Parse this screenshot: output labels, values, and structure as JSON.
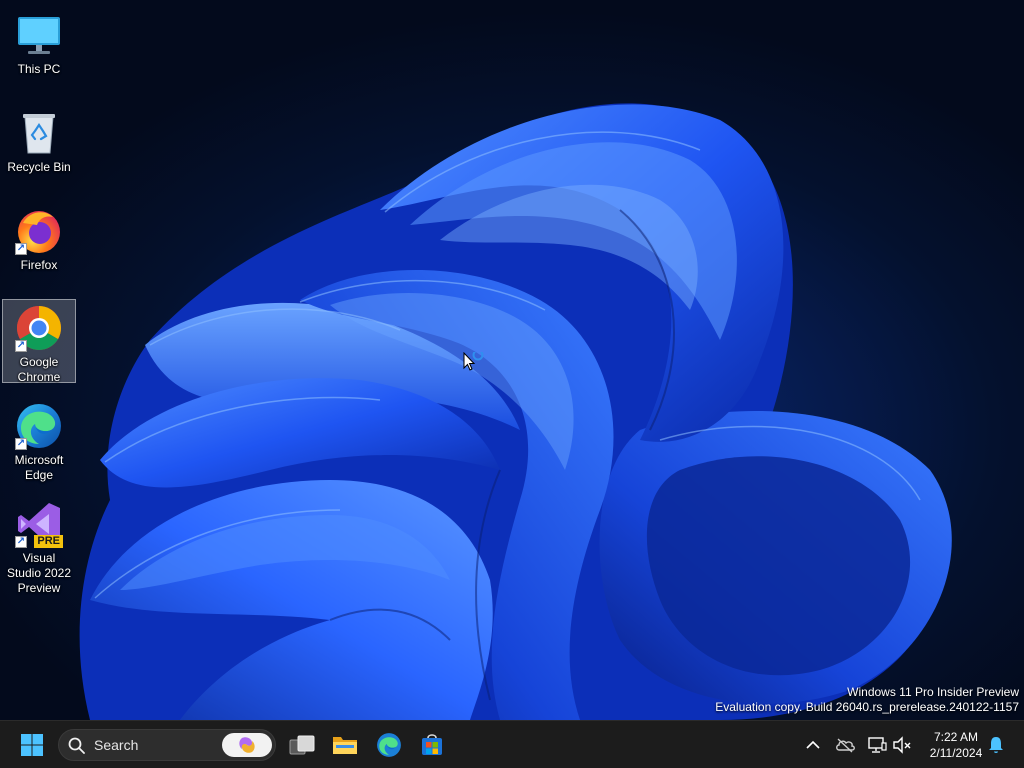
{
  "desktop": {
    "icons": [
      {
        "label": "This PC",
        "icon": "monitor-icon"
      },
      {
        "label": "Recycle Bin",
        "icon": "recycle-bin-icon"
      },
      {
        "label": "Firefox",
        "icon": "firefox-icon"
      },
      {
        "label": "Google Chrome",
        "icon": "chrome-icon",
        "selected": true
      },
      {
        "label": "Microsoft Edge",
        "icon": "edge-icon"
      },
      {
        "label": "Visual Studio 2022 Preview",
        "icon": "visual-studio-icon",
        "badge": "PRE"
      }
    ],
    "watermark": {
      "line1": "Windows 11 Pro Insider Preview",
      "line2": "Evaluation copy. Build 26040.rs_prerelease.240122-1157"
    }
  },
  "taskbar": {
    "start_icon": "windows-start-icon",
    "search": {
      "placeholder": "Search",
      "icon": "search-icon"
    },
    "pinned": [
      {
        "name": "task-view",
        "icon": "task-view-icon"
      },
      {
        "name": "file-explorer",
        "icon": "folder-icon"
      },
      {
        "name": "microsoft-edge",
        "icon": "edge-icon"
      },
      {
        "name": "microsoft-store",
        "icon": "store-icon"
      }
    ],
    "tray": {
      "icons": [
        "chevron-up-icon",
        "onedrive-offline-icon",
        "network-icon",
        "volume-muted-icon",
        "notification-bell-icon"
      ],
      "time": "7:22 AM",
      "date": "2/11/2024"
    }
  },
  "colors": {
    "taskbar_bg": "#1c1c1c",
    "accent_blue": "#0078d4",
    "wallpaper_bloom": "#1e5cff"
  }
}
